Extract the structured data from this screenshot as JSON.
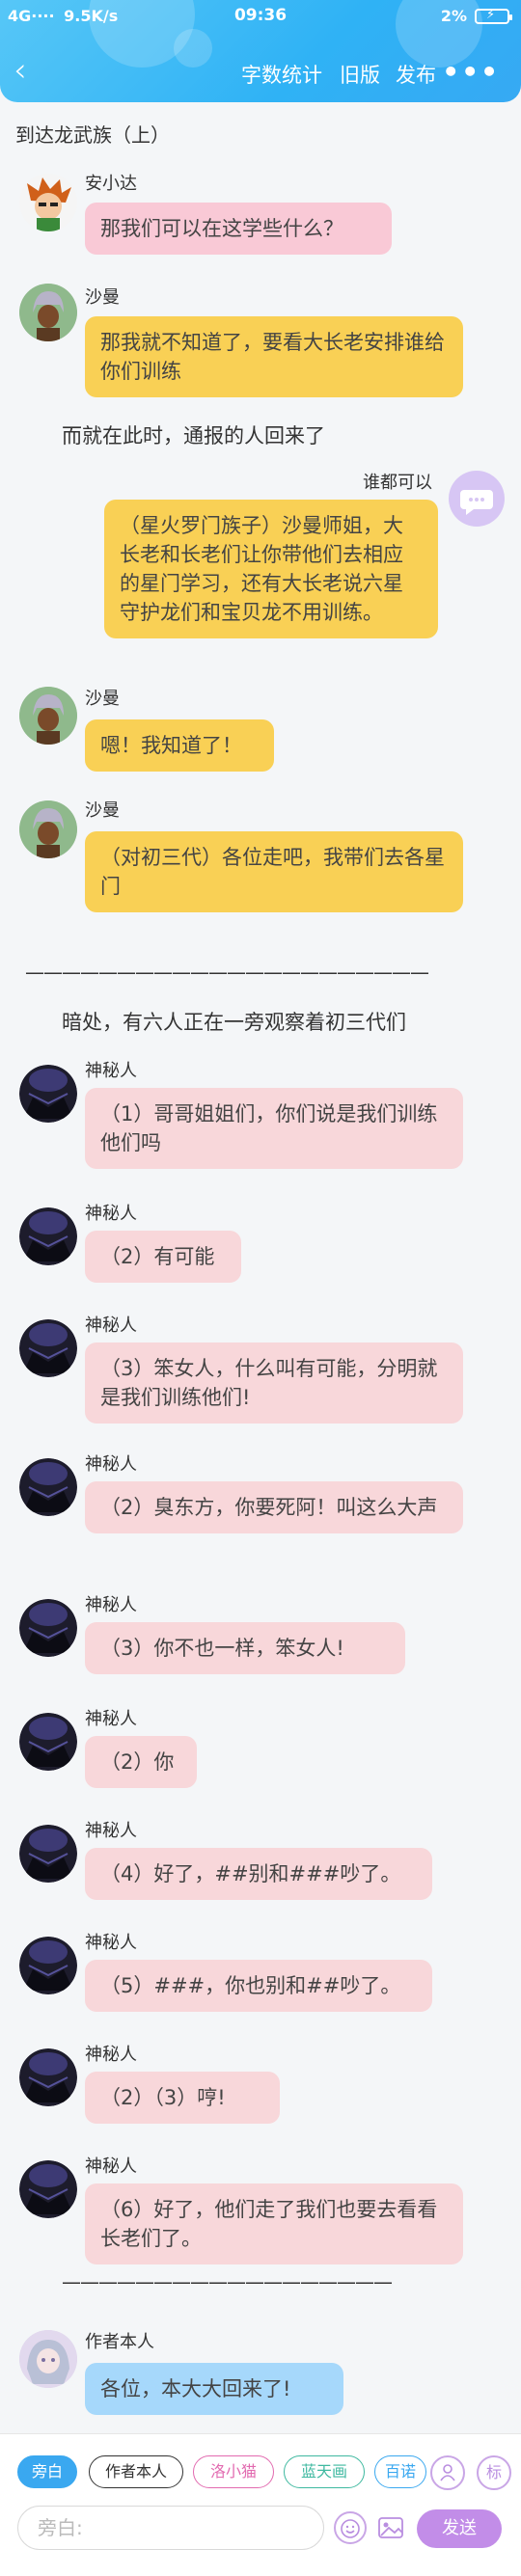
{
  "status_bar": {
    "signal": "4G····",
    "speed": "9.5K/s",
    "time": "09:36",
    "battery": "2%"
  },
  "navbar": {
    "word_count": "字数统计",
    "old_version": "旧版",
    "publish": "发布",
    "more": "•••"
  },
  "chapter_title": "到达龙武族（上）",
  "messages": [
    {
      "speaker": "安小达",
      "text": "那我们可以在这学些什么？"
    },
    {
      "speaker": "沙曼",
      "text": "那我就不知道了，要看大长老安排谁给你们训练"
    },
    {
      "narration": "而就在此时，通报的人回来了"
    },
    {
      "speaker": "谁都可以",
      "text": "（星火罗门族子）沙曼师姐，大长老和长老们让你带他们去相应的星门学习，还有大长老说六星守护龙们和宝贝龙不用训练。"
    },
    {
      "speaker": "沙曼",
      "text": "嗯！我知道了！"
    },
    {
      "speaker": "沙曼",
      "text": "（对初三代）各位走吧，我带们去各星门"
    },
    {
      "divider": "——————————————————————"
    },
    {
      "narration": "暗处，有六人正在一旁观察着初三代们"
    },
    {
      "speaker": "神秘人",
      "text": "（1）哥哥姐姐们，你们说是我们训练他们吗"
    },
    {
      "speaker": "神秘人",
      "text": "（2）有可能"
    },
    {
      "speaker": "神秘人",
      "text": "（3）笨女人，什么叫有可能，分明就是我们训练他们!"
    },
    {
      "speaker": "神秘人",
      "text": "（2）臭东方，你要死阿！叫这么大声"
    },
    {
      "speaker": "神秘人",
      "text": "（3）你不也一样，笨女人!"
    },
    {
      "speaker": "神秘人",
      "text": "（2）你"
    },
    {
      "speaker": "神秘人",
      "text": "（4）好了，##别和###吵了。"
    },
    {
      "speaker": "神秘人",
      "text": "（5）###，你也别和##吵了。"
    },
    {
      "speaker": "神秘人",
      "text": "（2）（3）哼!"
    },
    {
      "speaker": "神秘人",
      "text": "（6）好了，他们走了我们也要去看看长老们了。"
    },
    {
      "divider": "——————————————————"
    },
    {
      "speaker": "作者本人",
      "text": "各位，本大大回来了!"
    }
  ],
  "bottom_bar": {
    "chips": [
      "旁白",
      "作者本人",
      "洛小猫",
      "蓝天画",
      "百诺"
    ],
    "chip_colors": [
      "#3aa8f0",
      "#333333",
      "#e26bb0",
      "#3fb9a0",
      "#3aa8f0"
    ],
    "input_placeholder": "旁白:",
    "send": "发送",
    "tag_btn": "标"
  },
  "colors": {
    "header": "#36a9f3",
    "yellow_bubble": "#f9d055",
    "pink_bubble": "#f8d7da",
    "blue_bubble": "#a6d8fb",
    "send": "#c28de8"
  }
}
